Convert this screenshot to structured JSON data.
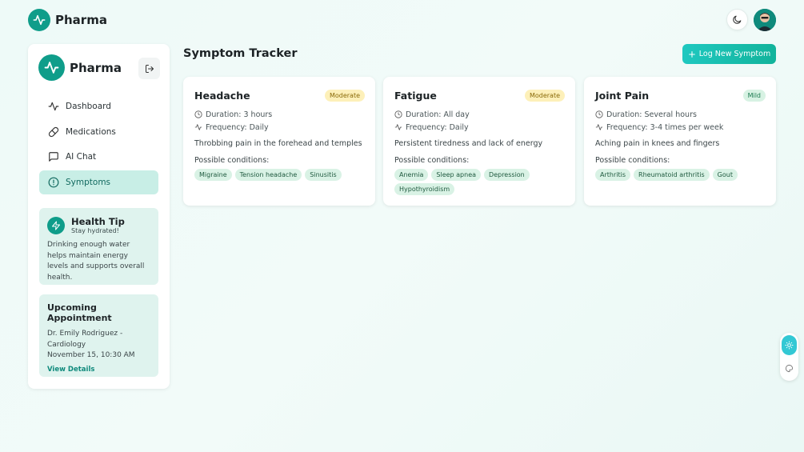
{
  "app": {
    "name": "Pharma"
  },
  "header": {
    "theme_icon": "moon-icon",
    "avatar_icon": "user-avatar"
  },
  "sidebar": {
    "brand": "Pharma",
    "logout_icon": "logout-icon",
    "items": [
      {
        "label": "Dashboard",
        "icon": "activity-icon",
        "active": false
      },
      {
        "label": "Medications",
        "icon": "pill-icon",
        "active": false
      },
      {
        "label": "AI Chat",
        "icon": "chat-icon",
        "active": false
      },
      {
        "label": "Symptoms",
        "icon": "alert-circle-icon",
        "active": true
      }
    ],
    "tip": {
      "title": "Health Tip",
      "subtitle": "Stay hydrated!",
      "body": "Drinking enough water helps maintain energy levels and supports overall health."
    },
    "appointment": {
      "title": "Upcoming Appointment",
      "doctor": "Dr. Emily Rodriguez - Cardiology",
      "time": "November 15, 10:30 AM",
      "link": "View Details"
    }
  },
  "main": {
    "title": "Symptom Tracker",
    "log_button": "Log New Symptom",
    "conditions_label": "Possible conditions:",
    "cards": [
      {
        "name": "Headache",
        "severity": "Moderate",
        "duration": "Duration: 3 hours",
        "frequency": "Frequency: Daily",
        "description": "Throbbing pain in the forehead and temples",
        "conditions": [
          "Migraine",
          "Tension headache",
          "Sinusitis"
        ]
      },
      {
        "name": "Fatigue",
        "severity": "Moderate",
        "duration": "Duration: All day",
        "frequency": "Frequency: Daily",
        "description": "Persistent tiredness and lack of energy",
        "conditions": [
          "Anemia",
          "Sleep apnea",
          "Depression",
          "Hypothyroidism"
        ]
      },
      {
        "name": "Joint Pain",
        "severity": "Mild",
        "duration": "Duration: Several hours",
        "frequency": "Frequency: 3-4 times per week",
        "description": "Aching pain in knees and fingers",
        "conditions": [
          "Arthritis",
          "Rheumatoid arthritis",
          "Gout"
        ]
      }
    ]
  },
  "float_tools": {
    "top_icon": "sun-icon",
    "bottom_icon": "palette-icon"
  },
  "colors": {
    "accent": "#0f9d8a",
    "active_nav": "#c8eee6",
    "moderate_badge": "#fdf0b9",
    "mild_badge": "#d7f2e3"
  }
}
